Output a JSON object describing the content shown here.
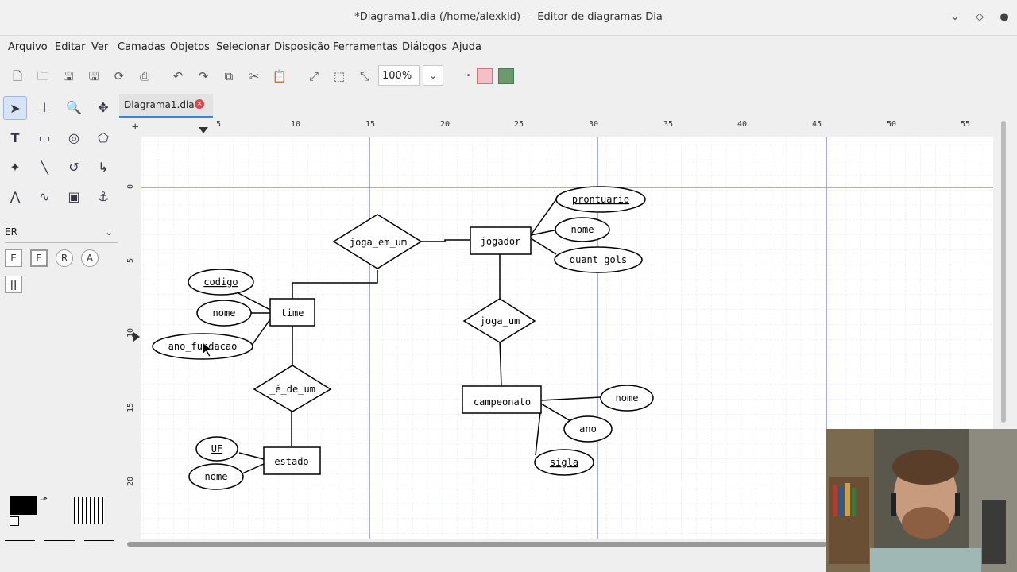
{
  "window": {
    "title": "*Diagrama1.dia (/home/alexkid) — Editor de diagramas Dia"
  },
  "menu": [
    "Arquivo",
    "Editar",
    "Ver",
    "Camadas",
    "Objetos",
    "Selecionar",
    "Disposição",
    "Ferramentas",
    "Diálogos",
    "Ajuda"
  ],
  "toolbar": {
    "zoom": "100%"
  },
  "sheet": {
    "selected": "ER"
  },
  "er_tools": [
    "E",
    "E",
    "R",
    "A"
  ],
  "tab": {
    "label": "Diagrama1.dia"
  },
  "ruler": {
    "horizontal": [
      "5",
      "10",
      "15",
      "20",
      "25",
      "30",
      "35",
      "40",
      "45",
      "50",
      "55"
    ],
    "vertical": [
      "0",
      "5",
      "10",
      "15",
      "20"
    ]
  },
  "diagram": {
    "entities": [
      "jogador",
      "time",
      "campeonato",
      "estado"
    ],
    "relationships": [
      "joga_em_um",
      "joga_um",
      "_é_de_um"
    ],
    "attributes": {
      "jogador": [
        "prontuario",
        "nome",
        "quant_gols"
      ],
      "time": [
        "codigo",
        "nome",
        "ano_fundacao"
      ],
      "campeonato": [
        "nome",
        "ano",
        "sigla"
      ],
      "estado": [
        "UF",
        "nome"
      ]
    }
  }
}
